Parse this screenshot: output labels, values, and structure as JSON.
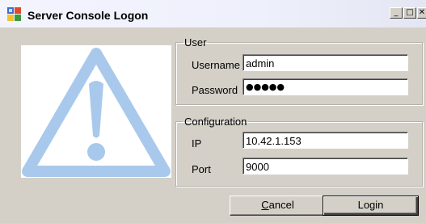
{
  "window": {
    "title": "Server Console Logon"
  },
  "caption_buttons": {
    "minimize": "_",
    "maximize": "□",
    "close": "✕"
  },
  "user_group": {
    "legend": "User",
    "username_label": "Username",
    "username_value": "admin",
    "password_label": "Password",
    "password_mask": "●●●●●"
  },
  "config_group": {
    "legend": "Configuration",
    "ip_label": "IP",
    "ip_value": "10.42.1.153",
    "port_label": "Port",
    "port_value": "9000"
  },
  "buttons": {
    "cancel_accel": "C",
    "cancel_rest": "ancel",
    "login_label": "Login"
  },
  "colors": {
    "warning_icon": "#a9c9ec",
    "window_bg": "#d4d0c8"
  },
  "icons": {
    "app": "server-console-app-icon",
    "image": "warning-triangle-icon"
  }
}
